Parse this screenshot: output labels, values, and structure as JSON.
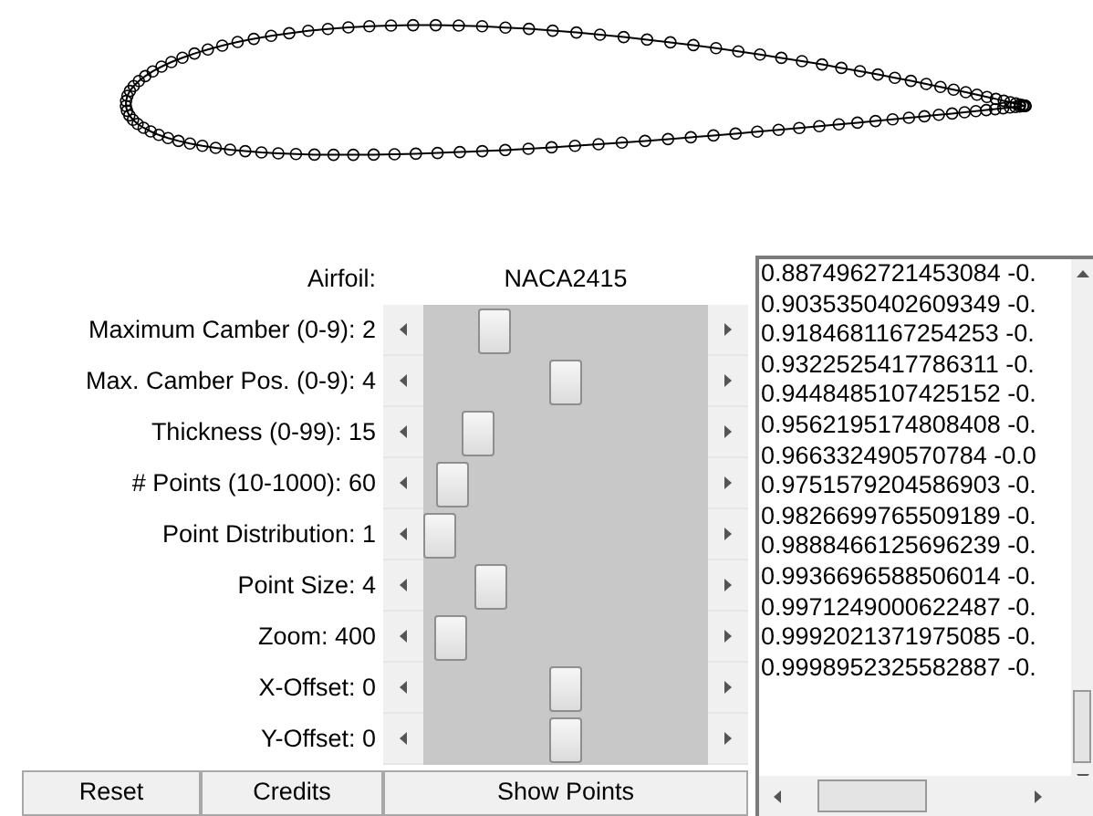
{
  "airfoil": {
    "label": "Airfoil:",
    "value": "NACA2415"
  },
  "sliders": [
    {
      "label": "Maximum Camber (0-9): 2",
      "level": 0.22
    },
    {
      "label": "Max. Camber Pos. (0-9): 4",
      "level": 0.5
    },
    {
      "label": "Thickness (0-99): 15",
      "level": 0.15
    },
    {
      "label": "# Points (10-1000): 60",
      "level": 0.05
    },
    {
      "label": "Point Distribution: 1",
      "level": 0.0
    },
    {
      "label": "Point Size: 4",
      "level": 0.2
    },
    {
      "label": "Zoom: 400",
      "level": 0.04
    },
    {
      "label": "X-Offset: 0",
      "level": 0.5
    },
    {
      "label": "Y-Offset: 0",
      "level": 0.5
    }
  ],
  "buttons": [
    "Reset",
    "Credits",
    "Show Points"
  ],
  "points_list": [
    "0.8874962721453084 -0.",
    "0.9035350402609349 -0.",
    "0.9184681167254253 -0.",
    "0.9322525417786311 -0.",
    "0.9448485107425152 -0.",
    "0.9562195174808408 -0.",
    "0.966332490570784 -0.0",
    "0.9751579204586903 -0.",
    "0.9826699765509189 -0.",
    "0.9888466125696239 -0.",
    "0.9936696588506014 -0.",
    "0.9971249000622487 -0.",
    "0.9992021371975085 -0.",
    "0.9998952325582887 -0."
  ]
}
